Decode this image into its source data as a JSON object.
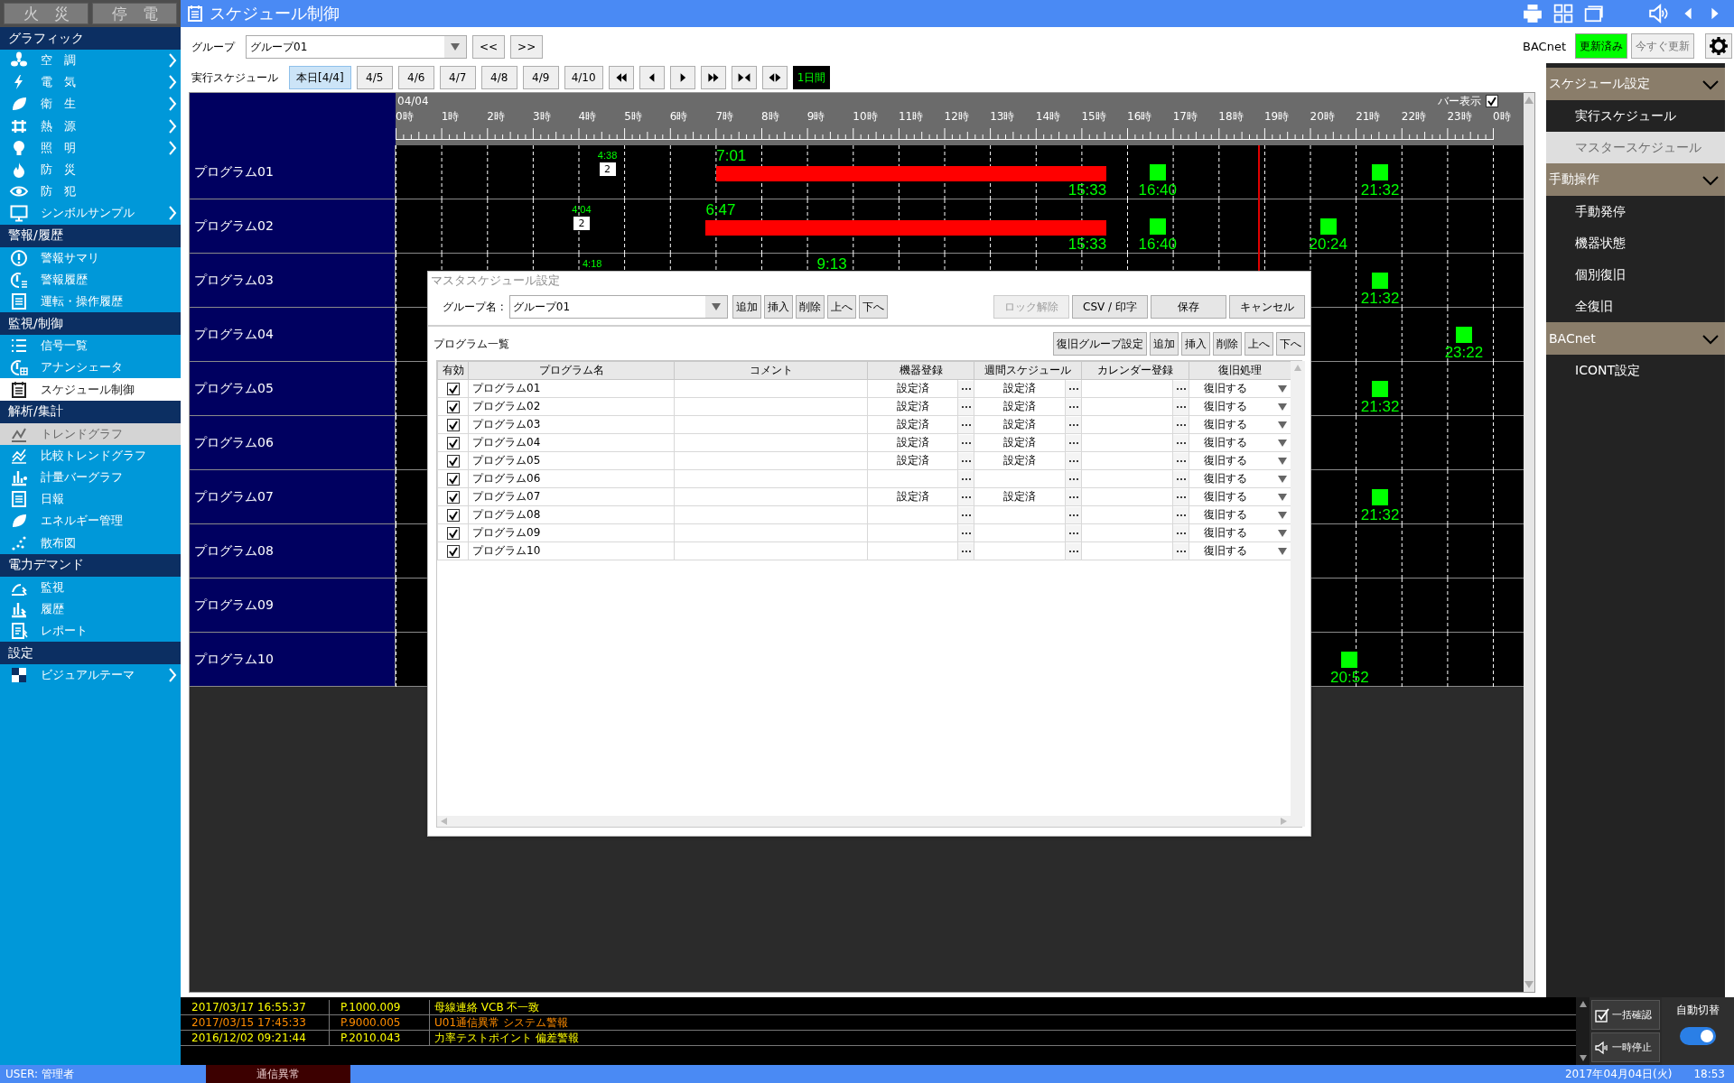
{
  "top_buttons": [
    {
      "label": "火　災"
    },
    {
      "label": "停　電"
    }
  ],
  "sidebar": {
    "sections": [
      {
        "title": "グラフィック",
        "items": [
          {
            "label": "空　調",
            "submenu": true,
            "selected": false,
            "disabled": false
          },
          {
            "label": "電　気",
            "submenu": true,
            "selected": false,
            "disabled": false
          },
          {
            "label": "衛　生",
            "submenu": true,
            "selected": false,
            "disabled": false
          },
          {
            "label": "熱　源",
            "submenu": true,
            "selected": false,
            "disabled": false
          },
          {
            "label": "照　明",
            "submenu": true,
            "selected": false,
            "disabled": false
          },
          {
            "label": "防　災",
            "submenu": false,
            "selected": false,
            "disabled": false
          },
          {
            "label": "防　犯",
            "submenu": false,
            "selected": false,
            "disabled": false
          },
          {
            "label": "シンボルサンプル",
            "submenu": true,
            "selected": false,
            "disabled": false
          }
        ]
      },
      {
        "title": "警報/履歴",
        "items": [
          {
            "label": "警報サマリ",
            "submenu": false,
            "selected": false,
            "disabled": false
          },
          {
            "label": "警報履歴",
            "submenu": false,
            "selected": false,
            "disabled": false
          },
          {
            "label": "運転・操作履歴",
            "submenu": false,
            "selected": false,
            "disabled": false
          }
        ]
      },
      {
        "title": "監視/制御",
        "items": [
          {
            "label": "信号一覧",
            "submenu": false,
            "selected": false,
            "disabled": false
          },
          {
            "label": "アナンシェータ",
            "submenu": false,
            "selected": false,
            "disabled": false
          },
          {
            "label": "スケジュール制御",
            "submenu": false,
            "selected": true,
            "disabled": false
          }
        ]
      },
      {
        "title": "解析/集計",
        "items": [
          {
            "label": "トレンドグラフ",
            "submenu": false,
            "selected": false,
            "disabled": true
          },
          {
            "label": "比較トレンドグラフ",
            "submenu": false,
            "selected": false,
            "disabled": false
          },
          {
            "label": "計量バーグラフ",
            "submenu": false,
            "selected": false,
            "disabled": false
          },
          {
            "label": "日報",
            "submenu": false,
            "selected": false,
            "disabled": false
          },
          {
            "label": "エネルギー管理",
            "submenu": false,
            "selected": false,
            "disabled": false
          },
          {
            "label": "散布図",
            "submenu": false,
            "selected": false,
            "disabled": false
          }
        ]
      },
      {
        "title": "電力デマンド",
        "items": [
          {
            "label": "監視",
            "submenu": false,
            "selected": false,
            "disabled": false
          },
          {
            "label": "履歴",
            "submenu": false,
            "selected": false,
            "disabled": false
          },
          {
            "label": "レポート",
            "submenu": false,
            "selected": false,
            "disabled": false
          }
        ]
      },
      {
        "title": "設定",
        "items": [
          {
            "label": "ビジュアルテーマ",
            "submenu": true,
            "selected": false,
            "disabled": false
          }
        ]
      }
    ]
  },
  "title_bar": {
    "title": "スケジュール制御"
  },
  "toolbar": {
    "group_label": "グループ",
    "group_value": "グループ01",
    "prev_button": "<<",
    "next_button": ">>",
    "schedule_label": "実行スケジュール",
    "day_tabs": [
      {
        "label": "本日[4/4]",
        "selected": true
      },
      {
        "label": "4/5",
        "selected": false
      },
      {
        "label": "4/6",
        "selected": false
      },
      {
        "label": "4/7",
        "selected": false
      },
      {
        "label": "4/8",
        "selected": false
      },
      {
        "label": "4/9",
        "selected": false
      },
      {
        "label": "4/10",
        "selected": false
      }
    ],
    "range_button": "1日間"
  },
  "bacnet": {
    "label": "BACnet",
    "status_button": "更新済み",
    "update_button": "今すぐ更新"
  },
  "timeline": {
    "date": "04/04",
    "bar_display": {
      "label": "バー表示",
      "checked": true
    },
    "hours": [
      "0時",
      "1時",
      "2時",
      "3時",
      "4時",
      "5時",
      "6時",
      "7時",
      "8時",
      "9時",
      "10時",
      "11時",
      "12時",
      "13時",
      "14時",
      "15時",
      "16時",
      "17時",
      "18時",
      "19時",
      "20時",
      "21時",
      "22時",
      "23時",
      "0時"
    ],
    "now_line": {
      "level": 0.786
    },
    "rows": [
      {
        "name": "プログラム01",
        "events": [
          {
            "kind": "count",
            "time": "4:38",
            "count": "2"
          },
          {
            "kind": "bar",
            "start": "7:01",
            "end": "15:33"
          },
          {
            "kind": "point",
            "time": "16:40"
          },
          {
            "kind": "point",
            "time": "21:32"
          }
        ]
      },
      {
        "name": "プログラム02",
        "events": [
          {
            "kind": "count",
            "time": "4:04",
            "count": "2"
          },
          {
            "kind": "bar",
            "start": "6:47",
            "end": "15:33"
          },
          {
            "kind": "point",
            "time": "16:40"
          },
          {
            "kind": "point",
            "time": "20:24"
          }
        ]
      },
      {
        "name": "プログラム03",
        "events": [
          {
            "kind": "count",
            "time": "4:18"
          },
          {
            "kind": "bar-start",
            "start": "9:13"
          },
          {
            "kind": "point",
            "time": "21:32"
          }
        ]
      },
      {
        "name": "プログラム04",
        "events": [
          {
            "kind": "point",
            "time": "23:22"
          }
        ]
      },
      {
        "name": "プログラム05",
        "events": [
          {
            "kind": "point",
            "time": "21:32"
          }
        ]
      },
      {
        "name": "プログラム06",
        "events": []
      },
      {
        "name": "プログラム07",
        "events": [
          {
            "kind": "point",
            "time": "21:32"
          }
        ]
      },
      {
        "name": "プログラム08",
        "events": []
      },
      {
        "name": "プログラム09",
        "events": []
      },
      {
        "name": "プログラム10",
        "events": [
          {
            "kind": "point",
            "time": "20:52"
          }
        ]
      }
    ]
  },
  "dialog": {
    "title": "マスタスケジュール設定",
    "group_label": "グループ名 :",
    "group_value": "グループ01",
    "edit_buttons": [
      "追加",
      "挿入",
      "削除",
      "上へ",
      "下へ"
    ],
    "action_buttons": [
      {
        "label": "ロック解除",
        "disabled": true
      },
      {
        "label": "CSV / 印字",
        "disabled": false
      },
      {
        "label": "保存",
        "disabled": false
      },
      {
        "label": "キャンセル",
        "disabled": false
      }
    ],
    "list_title": "プログラム一覧",
    "list_buttons": [
      "復旧グループ設定",
      "追加",
      "挿入",
      "削除",
      "上へ",
      "下へ"
    ],
    "columns": [
      "有効",
      "プログラム名",
      "コメント",
      "機器登録",
      "週間スケジュール",
      "カレンダー登録",
      "復旧処理"
    ],
    "rows": [
      {
        "enabled": true,
        "name": "プログラム01",
        "device": "設定済",
        "weekly": "設定済",
        "recovery": "復旧する"
      },
      {
        "enabled": true,
        "name": "プログラム02",
        "device": "設定済",
        "weekly": "設定済",
        "recovery": "復旧する"
      },
      {
        "enabled": true,
        "name": "プログラム03",
        "device": "設定済",
        "weekly": "設定済",
        "recovery": "復旧する"
      },
      {
        "enabled": true,
        "name": "プログラム04",
        "device": "設定済",
        "weekly": "設定済",
        "recovery": "復旧する"
      },
      {
        "enabled": true,
        "name": "プログラム05",
        "device": "設定済",
        "weekly": "設定済",
        "recovery": "復旧する"
      },
      {
        "enabled": true,
        "name": "プログラム06",
        "recovery": "復旧する"
      },
      {
        "enabled": true,
        "name": "プログラム07",
        "device": "設定済",
        "weekly": "設定済",
        "recovery": "復旧する"
      },
      {
        "enabled": true,
        "name": "プログラム08",
        "recovery": "復旧する"
      },
      {
        "enabled": true,
        "name": "プログラム09",
        "recovery": "復旧する"
      },
      {
        "enabled": true,
        "name": "プログラム10",
        "recovery": "復旧する"
      }
    ]
  },
  "side_panel": {
    "sections": [
      {
        "title": "スケジュール設定",
        "items": [
          {
            "label": "実行スケジュール",
            "selected": false
          },
          {
            "label": "マスタースケジュール",
            "selected": true
          }
        ]
      },
      {
        "title": "手動操作",
        "items": [
          {
            "label": "手動発停",
            "selected": false
          },
          {
            "label": "機器状態",
            "selected": false
          },
          {
            "label": "個別復旧",
            "selected": false
          },
          {
            "label": "全復旧",
            "selected": false
          }
        ]
      },
      {
        "title": "BACnet",
        "items": [
          {
            "label": "ICONT設定",
            "selected": false
          }
        ]
      }
    ]
  },
  "alarms": [
    {
      "time": "2017/03/17 16:55:37",
      "point": "P.1000.009",
      "message": "母線連絡 VCB 不一致",
      "color": "#ffff00"
    },
    {
      "time": "2017/03/15 17:45:33",
      "point": "P.9000.005",
      "message": "U01通信異常 システム警報",
      "color": "#ff8c00"
    },
    {
      "time": "2016/12/02 09:21:44",
      "point": "P.2010.043",
      "message": "力率テストポイント 偏差警報",
      "color": "#ffff00"
    }
  ],
  "alarm_controls": {
    "confirm_button": "一括確認",
    "pause_button": "一時停止",
    "auto_switch": {
      "label": "自動切替",
      "on": true
    }
  },
  "status_bar": {
    "user": "USER: 管理者",
    "alert": "通信異常",
    "date": "2017年04月04日(火)",
    "time": "18:53"
  }
}
